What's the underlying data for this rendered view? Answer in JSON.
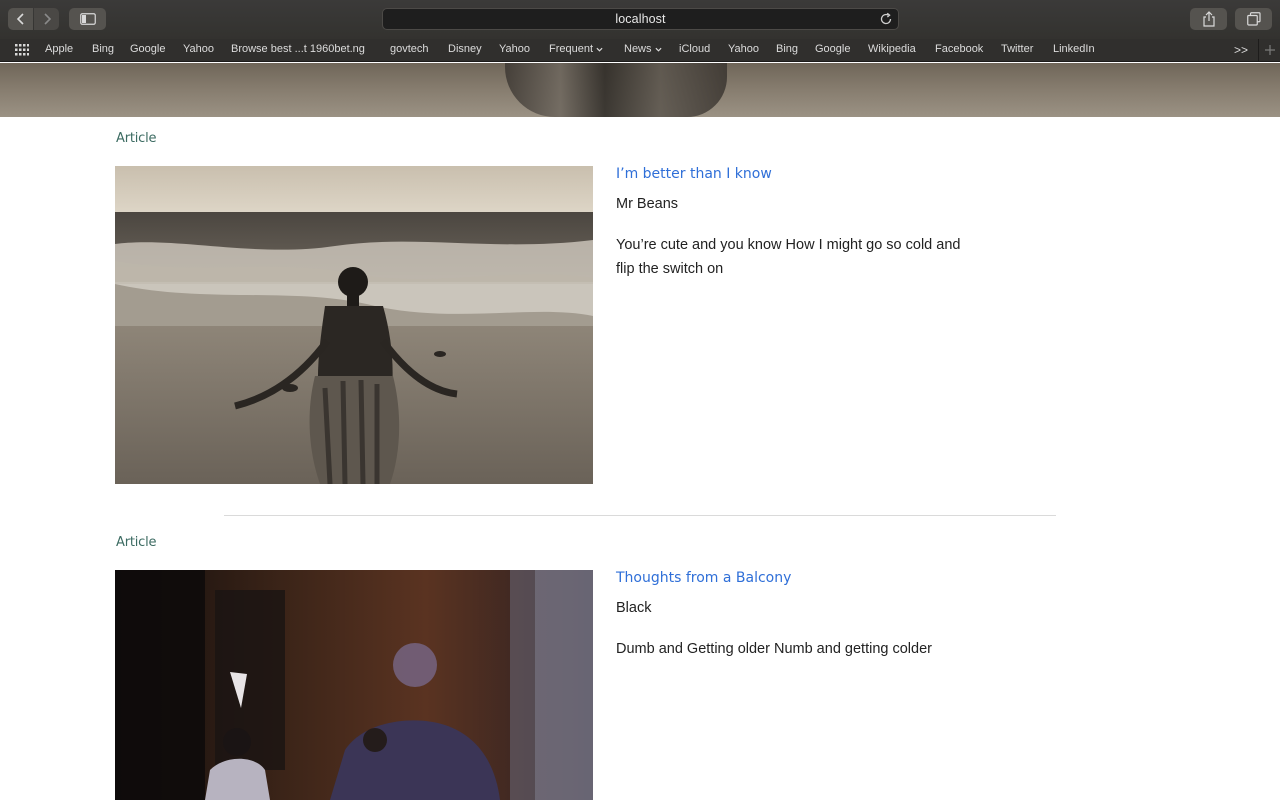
{
  "browser": {
    "address": "localhost",
    "favorites": [
      {
        "label": "Apple"
      },
      {
        "label": "Bing"
      },
      {
        "label": "Google"
      },
      {
        "label": "Yahoo"
      },
      {
        "label": "Browse best ...t 1960bet.ng"
      },
      {
        "label": "govtech"
      },
      {
        "label": "Disney"
      },
      {
        "label": "Yahoo"
      },
      {
        "label": "Frequent",
        "dropdown": true
      },
      {
        "label": "News",
        "dropdown": true
      },
      {
        "label": "iCloud"
      },
      {
        "label": "Yahoo"
      },
      {
        "label": "Bing"
      },
      {
        "label": "Google"
      },
      {
        "label": "Wikipedia"
      },
      {
        "label": "Facebook"
      },
      {
        "label": "Twitter"
      },
      {
        "label": "LinkedIn"
      }
    ],
    "more_label": ">>"
  },
  "articles": [
    {
      "tag": "Article",
      "title": "I’m better than I know",
      "author": "Mr Beans",
      "excerpt": "You’re cute and you know How I might go so cold and flip the switch on"
    },
    {
      "tag": "Article",
      "title": "Thoughts from a Balcony",
      "author": "Black",
      "excerpt": "Dumb and Getting older Numb and getting colder"
    }
  ],
  "colors": {
    "link": "#2f6fd8",
    "tag": "#3c6b62",
    "chrome": "#3b3a39"
  }
}
